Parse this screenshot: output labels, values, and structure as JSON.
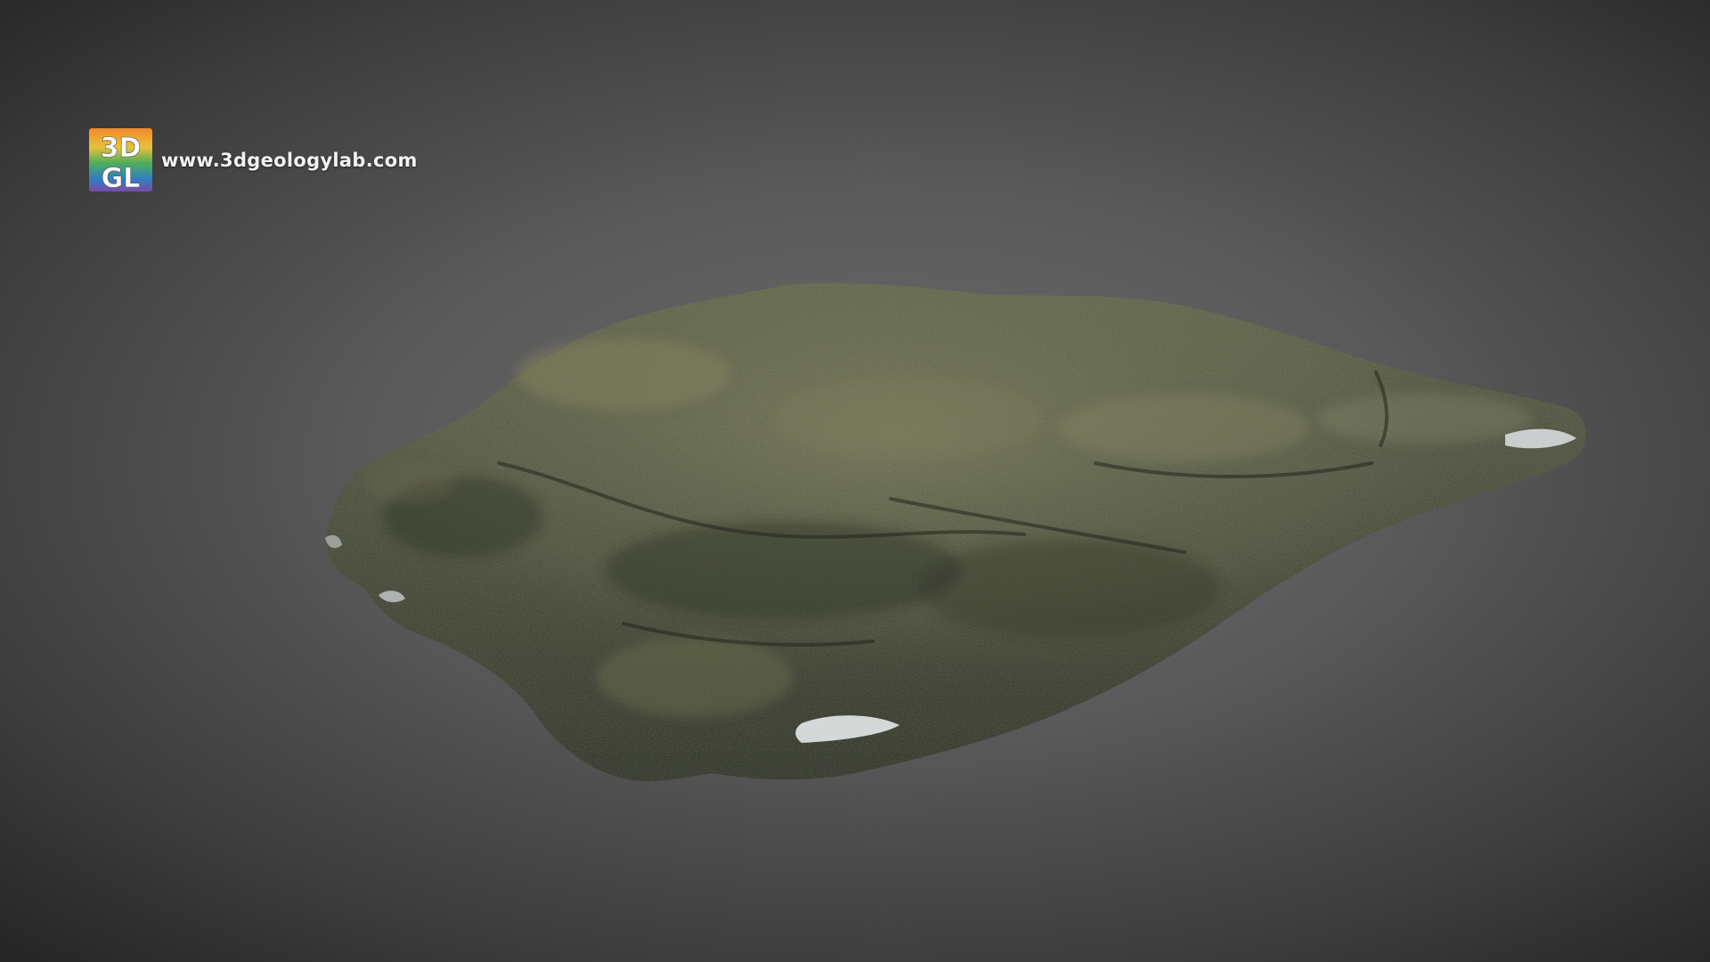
{
  "watermark": {
    "logo_line1": "3D",
    "logo_line2": "GL",
    "url": "www.3dgeologylab.com"
  },
  "scene": {
    "subject": "rock-specimen",
    "background_color": "#5a5a5a",
    "rock_base_color": "#4f5540",
    "rock_highlight_color": "#8a8a62"
  }
}
